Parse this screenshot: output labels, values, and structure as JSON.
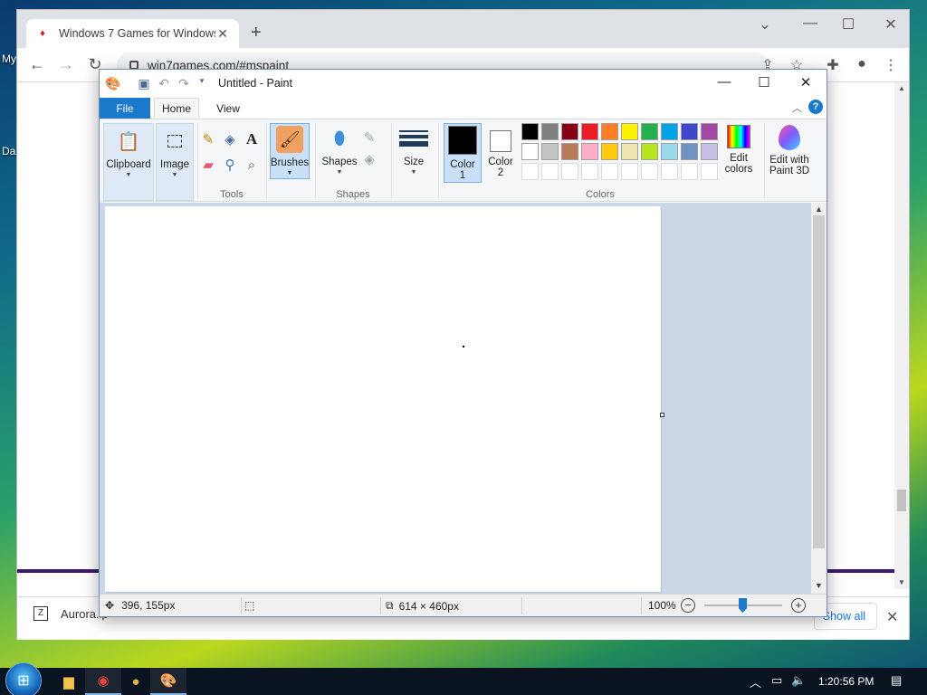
{
  "desktop": {
    "label_1": "My",
    "label_2": "Da"
  },
  "browser": {
    "tab_title": "Windows 7 Games for Windows",
    "url": "win7games.com/#mspaint",
    "download": {
      "filename": "Aurora.lp",
      "show_all": "Show all"
    }
  },
  "paint": {
    "title": "Untitled - Paint",
    "tabs": {
      "file": "File",
      "home": "Home",
      "view": "View"
    },
    "ribbon": {
      "clipboard": "Clipboard",
      "image": "Image",
      "tools_group": "Tools",
      "brushes": "Brushes",
      "shapes": "Shapes",
      "shapes_group": "Shapes",
      "size": "Size",
      "color1_line1": "Color",
      "color1_line2": "1",
      "color2_line1": "Color",
      "color2_line2": "2",
      "edit_colors_line1": "Edit",
      "edit_colors_line2": "colors",
      "paint3d_line1": "Edit with",
      "paint3d_line2": "Paint 3D",
      "colors_group": "Colors"
    },
    "palette_row1": [
      "#000000",
      "#7f7f7f",
      "#880015",
      "#ed1c24",
      "#ff7f27",
      "#fff200",
      "#22b14c",
      "#00a2e8",
      "#3f48cc",
      "#a349a4"
    ],
    "palette_row2": [
      "#ffffff",
      "#c3c3c3",
      "#b97a57",
      "#ffaec9",
      "#ffc90e",
      "#efe4b0",
      "#b5e61d",
      "#99d9ea",
      "#7092be",
      "#c8bfe7"
    ],
    "status": {
      "cursor_pos": "396, 155px",
      "canvas_size": "614 × 460px",
      "zoom": "100%"
    }
  },
  "taskbar": {
    "time": "1:20:56 PM"
  }
}
